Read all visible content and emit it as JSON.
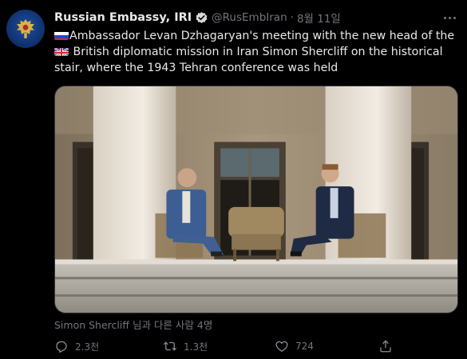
{
  "tweet": {
    "author_name": "Russian Embassy, IRI",
    "handle": "@RusEmbIran",
    "separator": "·",
    "date": "8월 11일",
    "text_part1": "Ambassador Levan Dzhagaryan's meeting with the new head of the",
    "text_part2": "British diplomatic mission in Iran Simon Shercliff on the historical stair, where the 1943 Tehran conference was held",
    "tagged": "Simon Shercliff 님과 다른 사람 4명"
  },
  "actions": {
    "reply_count": "2.3천",
    "retweet_count": "1.3천",
    "like_count": "724"
  },
  "icons": {
    "avatar": "russian-coat-of-arms-icon",
    "verified": "verified-badge-icon",
    "more": "more-icon",
    "reply": "reply-icon",
    "retweet": "retweet-icon",
    "like": "heart-icon",
    "share": "share-icon"
  },
  "colors": {
    "background": "#000000",
    "text": "#e7e9ea",
    "muted": "#71767b",
    "verified": "#d9d9d9"
  }
}
